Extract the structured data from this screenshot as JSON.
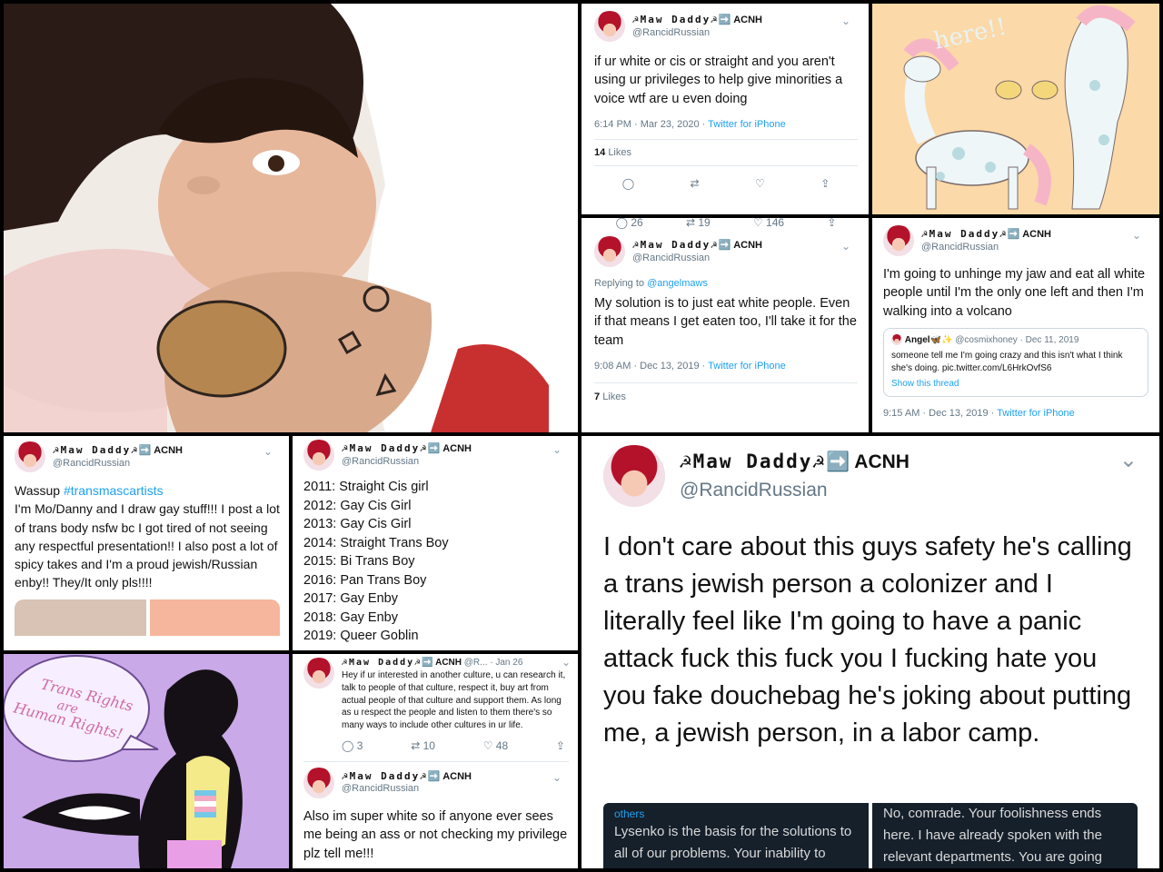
{
  "profile": {
    "display_name": "☭Maw Daddy☭",
    "badge": "➡️ ACNH",
    "handle": "@RancidRussian"
  },
  "tweet_privilege": {
    "text": "if ur white or cis or straight and you aren't using ur privileges to help give minorities a voice wtf are u even doing",
    "time": "6:14 PM · Mar 23, 2020",
    "source": "Twitter for iPhone",
    "likes_count": "14",
    "likes_label": "Likes"
  },
  "art_top_right": {
    "caption": "here!!"
  },
  "tweet_eat": {
    "prev_stats": [
      "26",
      "19",
      "146"
    ],
    "replying_label": "Replying to",
    "replying_to": "@angelmaws",
    "text": "My solution is to just eat white people. Even if that means I get eaten too, I'll take it for the team",
    "time": "9:08 AM · Dec 13, 2019",
    "source": "Twitter for iPhone",
    "likes_count": "7",
    "likes_label": "Likes"
  },
  "tweet_volcano": {
    "text": "I'm going to unhinge my jaw and eat all white people until I'm the only one left and then I'm walking into a volcano",
    "quote": {
      "name": "Angel🦋✨",
      "handle_date": "@cosmixhoney · Dec 11, 2019",
      "text": "someone tell me I'm going crazy and this isn't what I think she's doing. pic.twitter.com/L6HrkOvfS6",
      "show_thread": "Show this thread"
    },
    "time": "9:15 AM · Dec 13, 2019",
    "source": "Twitter for iPhone"
  },
  "tweet_intro": {
    "text_before": "Wassup ",
    "hashtag": "#transmascartists",
    "text_after": "I'm Mo/Danny and I draw gay stuff!!! I post a lot of trans body nsfw bc I got tired of not seeing any respectful presentation!! I also post a lot of spicy takes and I'm a proud jewish/Russian enby!! They/It only pls!!!!"
  },
  "tweet_timeline": {
    "lines": [
      "2011: Straight Cis girl",
      "2012: Gay Cis Girl",
      "2013: Gay Cis Girl",
      "2014: Straight Trans Boy",
      "2015: Bi Trans Boy",
      "2016: Pan Trans Boy",
      "2017: Gay Enby",
      "2018: Gay Enby",
      "2019: Queer Goblin"
    ]
  },
  "art_bottom_left": {
    "bubble_line1": "Trans Rights",
    "bubble_line2": "are",
    "bubble_line3": "Human Rights!"
  },
  "tweet_culture": {
    "handle_short": "@R...",
    "date": "· Jan 26",
    "text": "Hey if ur interested in another culture, u can research it, talk to people of that culture, respect it, buy art from actual people of that culture and support them. As long as u respect the people and listen to them there's so many ways to include other cultures in ur life.",
    "replies": "3",
    "retweets": "10",
    "likes": "48"
  },
  "tweet_white": {
    "text": "Also im super white so if anyone ever sees me being an ass or not checking my privilege plz tell me!!!"
  },
  "tweet_big": {
    "text": "I don't care about this guys safety he's calling a trans jewish person a colonizer and I literally feel like I'm going to have a panic attack fuck this fuck you I fucking hate you you fake douchebag he's joking about putting me, a jewish person, in a labor camp.",
    "embed_left_label": "others",
    "embed_left_text": "Lysenko is the basis for the solutions to all of our problems. Your inability to",
    "embed_right_text": "No, comrade. Your foolishness ends here. I have already spoken with the relevant departments. You are going"
  },
  "colors": {
    "link": "#1da1f2",
    "meta": "#657786",
    "divider": "#000000"
  }
}
